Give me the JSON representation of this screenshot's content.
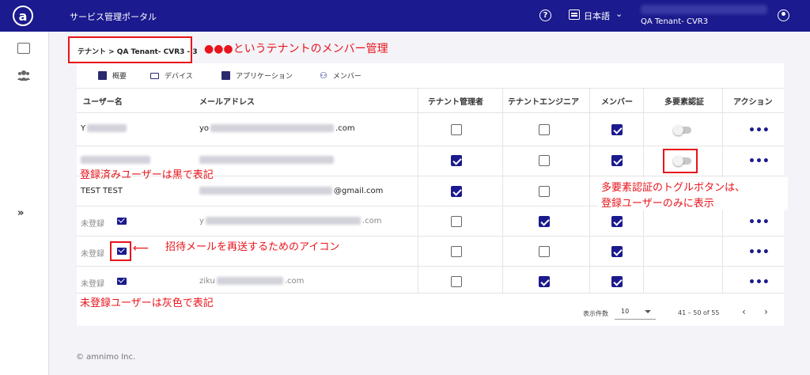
{
  "topbar": {
    "app_title": "サービス管理ポータル",
    "help_symbol": "?",
    "language": "日本語",
    "chevron": "⌄",
    "tenant": "QA Tenant- CVR3",
    "logo_letter": "a"
  },
  "sidebar": {
    "expand_symbol": "»"
  },
  "breadcrumb": "テナント > QA Tenant- CVR3 - 3",
  "tabs": [
    {
      "label": "概要",
      "icon": "document-icon"
    },
    {
      "label": "デバイス",
      "icon": "device-icon"
    },
    {
      "label": "アプリケーション",
      "icon": "app-icon"
    },
    {
      "label": "メンバー",
      "icon": "members-icon"
    }
  ],
  "table": {
    "headers": [
      "ユーザー名",
      "メールアドレス",
      "テナント管理者",
      "テナントエンジニア",
      "メンバー",
      "多要素認証",
      "アクション"
    ],
    "rows": [
      {
        "username": "Y",
        "email_prefix": "yo",
        "email_suffix": ".com",
        "registered": true,
        "admin": false,
        "engineer": false,
        "member": true,
        "mfa_toggle": true
      },
      {
        "username": "",
        "email_prefix": "",
        "email_suffix": "",
        "registered": true,
        "admin": true,
        "engineer": false,
        "member": true,
        "mfa_toggle": true
      },
      {
        "username": "TEST TEST",
        "email_prefix": "",
        "email_suffix": "@gmail.com",
        "registered": true,
        "admin": true,
        "engineer": false,
        "member": true,
        "mfa_toggle": false
      },
      {
        "username": "未登録",
        "email_prefix": "y",
        "email_suffix": ".com",
        "registered": false,
        "admin": false,
        "engineer": true,
        "member": true,
        "mfa_toggle": false
      },
      {
        "username": "未登録",
        "email_prefix": "",
        "email_suffix": "",
        "registered": false,
        "admin": false,
        "engineer": false,
        "member": true,
        "mfa_toggle": false
      },
      {
        "username": "未登録",
        "email_prefix": "ziku",
        "email_suffix": ".com",
        "registered": false,
        "admin": false,
        "engineer": true,
        "member": true,
        "mfa_toggle": false
      }
    ],
    "action_symbol": "•••"
  },
  "pagination": {
    "per_page_label": "表示件数",
    "per_page_value": "10",
    "range": "41 – 50 of 55",
    "prev": "‹",
    "next": "›"
  },
  "annotations": {
    "title": "●●●というテナントのメンバー管理",
    "registered_black": "登録済みユーザーは黒で表記",
    "mfa_toggle_line1": "多要素認証のトグルボタンは、",
    "mfa_toggle_line2": "登録ユーザーのみに表示",
    "resend_icon": "招待メールを再送するためのアイコン",
    "unregistered_gray": "未登録ユーザーは灰色で表記",
    "arrow": "⟵"
  },
  "footer": "© amnimo Inc.",
  "colors": {
    "topbar": "#1b1a8e",
    "accent": "#1b1a8e",
    "annotation": "#e8141b"
  }
}
